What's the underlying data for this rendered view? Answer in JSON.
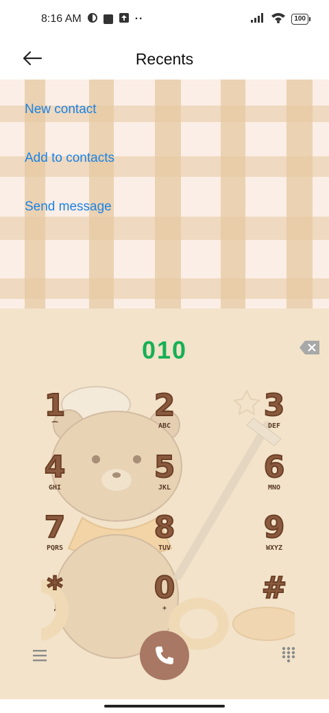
{
  "status_bar": {
    "time": "8:16 AM",
    "battery": "100"
  },
  "header": {
    "title": "Recents"
  },
  "actions": [
    {
      "label": "New contact"
    },
    {
      "label": "Add to contacts"
    },
    {
      "label": "Send message"
    }
  ],
  "dialer": {
    "number": "010",
    "keys": [
      {
        "digit": "1",
        "letters": "⁀"
      },
      {
        "digit": "2",
        "letters": "ABC"
      },
      {
        "digit": "3",
        "letters": "DEF"
      },
      {
        "digit": "4",
        "letters": "GHI"
      },
      {
        "digit": "5",
        "letters": "JKL"
      },
      {
        "digit": "6",
        "letters": "MNO"
      },
      {
        "digit": "7",
        "letters": "PQRS"
      },
      {
        "digit": "8",
        "letters": "TUV"
      },
      {
        "digit": "9",
        "letters": "WXYZ"
      },
      {
        "digit": "*",
        "letters": ","
      },
      {
        "digit": "0",
        "letters": "+"
      },
      {
        "digit": "#",
        "letters": ""
      }
    ]
  },
  "colors": {
    "link": "#1a82e6",
    "number": "#17b055",
    "call_button": "#a87864",
    "dialer_bg": "#f2e3ca"
  }
}
